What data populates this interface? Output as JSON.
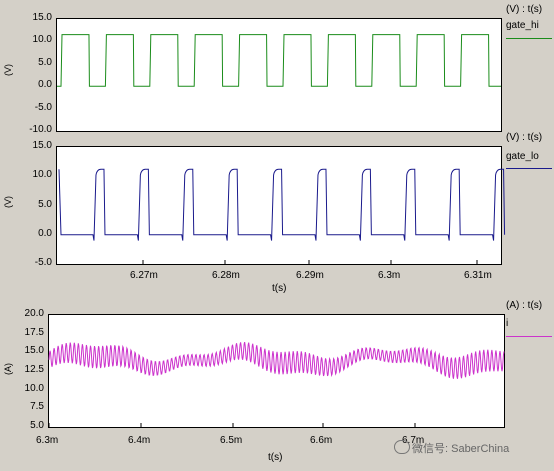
{
  "colors": {
    "background": "#d4d0c8",
    "gate_hi": "#1a8c1a",
    "gate_lo": "#1a1a8c",
    "i": "#cc33cc"
  },
  "plots": [
    {
      "id": "gate_hi",
      "legend_title": "(V) : t(s)",
      "series_name": "gate_hi",
      "ylabel": "(V)",
      "yticks": [
        "15.0",
        "10.0",
        "5.0",
        "0.0",
        "-5.0",
        "-10.0"
      ]
    },
    {
      "id": "gate_lo",
      "legend_title": "(V) : t(s)",
      "series_name": "gate_lo",
      "ylabel": "(V)",
      "yticks": [
        "15.0",
        "10.0",
        "5.0",
        "0.0",
        "-5.0"
      ],
      "xticks": [
        "6.27m",
        "6.28m",
        "6.29m",
        "6.3m",
        "6.31m"
      ],
      "xlabel": "t(s)"
    },
    {
      "id": "i",
      "legend_title": "(A) : t(s)",
      "series_name": "i",
      "ylabel": "(A)",
      "yticks": [
        "20.0",
        "17.5",
        "15.0",
        "12.5",
        "10.0",
        "7.5",
        "5.0"
      ],
      "xticks": [
        "6.3m",
        "6.4m",
        "6.5m",
        "6.6m",
        "6.7m"
      ],
      "xlabel": "t(s)"
    }
  ],
  "watermark": "微信号: SaberChina",
  "chart_data": [
    {
      "type": "line",
      "title": "",
      "series": [
        {
          "name": "gate_hi",
          "pattern": "square wave",
          "high": 11.5,
          "low": 0.0,
          "cycles": 10
        }
      ],
      "xlim": [
        0.00626,
        0.00631
      ],
      "ylim": [
        -10,
        15
      ],
      "ylabel": "(V)",
      "grid": false,
      "legend": "right"
    },
    {
      "type": "line",
      "title": "",
      "series": [
        {
          "name": "gate_lo",
          "pattern": "square wave",
          "high": 11.2,
          "low": 0.0,
          "cycles": 10
        }
      ],
      "xlim": [
        0.00626,
        0.00631
      ],
      "ylim": [
        -5,
        15
      ],
      "ylabel": "(V)",
      "xlabel": "t(s)",
      "grid": false,
      "legend": "right"
    },
    {
      "type": "line",
      "title": "",
      "series": [
        {
          "name": "i",
          "pattern": "ripple",
          "mean": 14.0,
          "ripple_pp": 3.0
        }
      ],
      "xlim": [
        0.0063,
        0.0067
      ],
      "ylim": [
        5,
        20
      ],
      "ylabel": "(A)",
      "xlabel": "t(s)",
      "grid": false,
      "legend": "right"
    }
  ]
}
